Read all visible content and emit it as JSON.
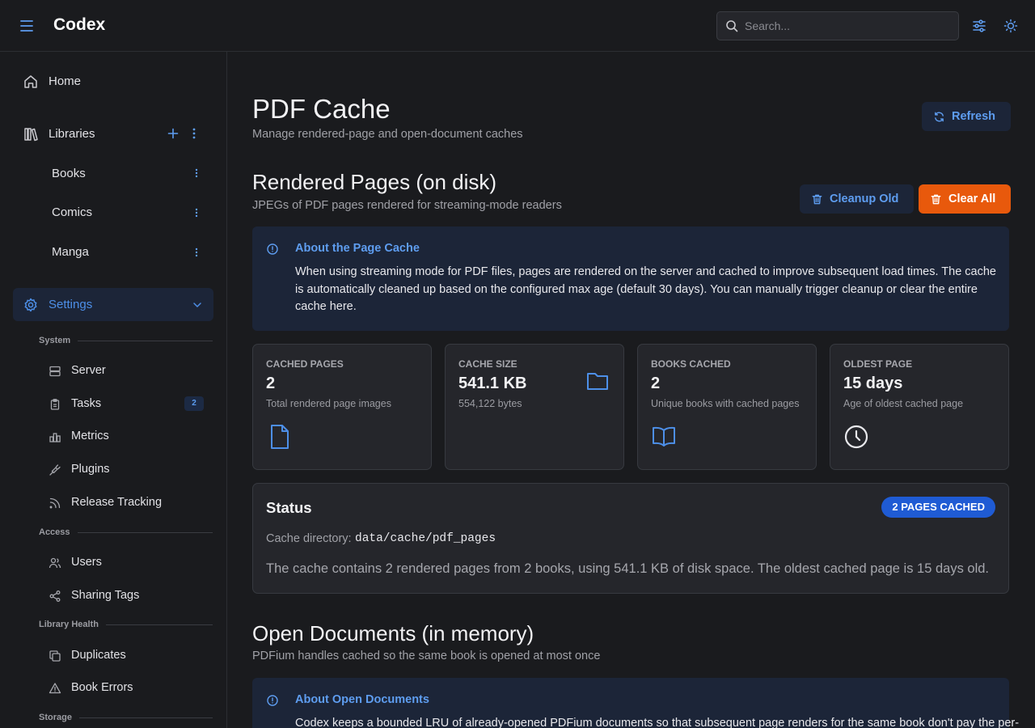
{
  "header": {
    "brand": "Codex",
    "search_placeholder": "Search..."
  },
  "sidebar": {
    "home": "Home",
    "libraries": "Libraries",
    "library_items": [
      "Books",
      "Comics",
      "Manga"
    ],
    "settings": "Settings",
    "sections": {
      "system": "System",
      "access": "Access",
      "library_health": "Library Health",
      "storage": "Storage"
    },
    "system_items": {
      "server": "Server",
      "tasks": "Tasks",
      "tasks_badge": "2",
      "metrics": "Metrics",
      "plugins": "Plugins",
      "release_tracking": "Release Tracking"
    },
    "access_items": {
      "users": "Users",
      "sharing_tags": "Sharing Tags"
    },
    "health_items": {
      "duplicates": "Duplicates",
      "book_errors": "Book Errors"
    }
  },
  "main": {
    "title": "PDF Cache",
    "subtitle": "Manage rendered-page and open-document caches",
    "refresh_label": "Refresh",
    "rendered": {
      "title": "Rendered Pages (on disk)",
      "subtitle": "JPEGs of PDF pages rendered for streaming-mode readers",
      "cleanup_label": "Cleanup Old",
      "clear_label": "Clear All",
      "info_title": "About the Page Cache",
      "info_text": "When using streaming mode for PDF files, pages are rendered on the server and cached to improve subsequent load times. The cache is automatically cleaned up based on the configured max age (default 30 days). You can manually trigger cleanup or clear the entire cache here."
    },
    "stats": {
      "cached_pages": {
        "label": "Cached Pages",
        "value": "2",
        "desc": "Total rendered page images"
      },
      "cache_size": {
        "label": "Cache Size",
        "value": "541.1 KB",
        "desc": "554,122 bytes"
      },
      "books_cached": {
        "label": "Books Cached",
        "value": "2",
        "desc": "Unique books with cached pages"
      },
      "oldest_page": {
        "label": "Oldest Page",
        "value": "15 days",
        "desc": "Age of oldest cached page"
      }
    },
    "status": {
      "title": "Status",
      "badge": "2 PAGES CACHED",
      "dir_label": "Cache directory:",
      "dir_value": "data/cache/pdf_pages",
      "summary": "The cache contains 2 rendered pages from 2 books, using 541.1 KB of disk space. The oldest cached page is 15 days old."
    },
    "open_docs": {
      "title": "Open Documents (in memory)",
      "subtitle": "PDFium handles cached so the same book is opened at most once",
      "info_title": "About Open Documents",
      "info_text": "Codex keeps a bounded LRU of already-opened PDFium documents so that subsequent page renders for the same book don't pay the per-"
    }
  },
  "colors": {
    "accent": "#4d8fe8",
    "danger": "#e8590c",
    "badge": "#1f5bd4"
  }
}
